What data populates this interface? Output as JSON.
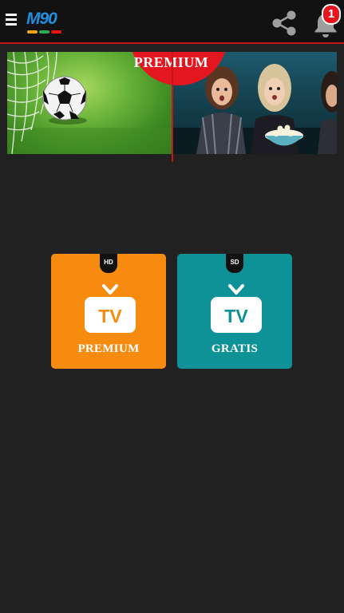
{
  "app": {
    "logo_text": "M90",
    "logo_colors": [
      "#f6a21a",
      "#2fa84f",
      "#e8141c"
    ],
    "accent_color": "#c8141e",
    "notification_count": "1",
    "icons": {
      "menu": "hamburger-menu-icon",
      "share": "share-icon",
      "notifications": "bell-icon"
    }
  },
  "banner": {
    "ribbon_label": "PREMIUM",
    "left_image": "soccer-ball-in-goal-net",
    "right_image": "people-watching-tv-with-popcorn"
  },
  "tiles": [
    {
      "quality": "HD",
      "icon_text": "TV",
      "label": "PREMIUM",
      "color": "#f68b10"
    },
    {
      "quality": "SD",
      "icon_text": "TV",
      "label": "GRATIS",
      "color": "#0f9297"
    }
  ]
}
